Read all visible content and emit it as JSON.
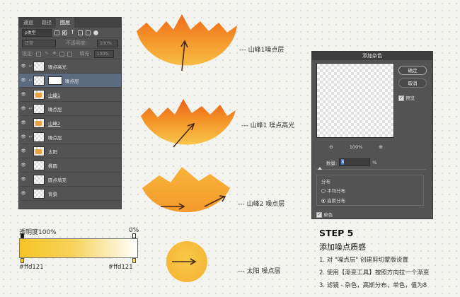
{
  "layers_panel": {
    "tabs": [
      "通道",
      "路径",
      "图层"
    ],
    "filter_label": "ρ类型",
    "blend_mode": "正常",
    "opacity_label": "不透明度:",
    "opacity_value": "100%",
    "lock_label": "锁定:",
    "fill_label": "填充:",
    "fill_value": "100%",
    "layers": [
      {
        "name": "噪点高光",
        "clip": true,
        "selected": false
      },
      {
        "name": "噪点层",
        "clip": true,
        "mask": true,
        "selected": true
      },
      {
        "name": "山峰1",
        "clip": false,
        "selected": false
      },
      {
        "name": "噪点层",
        "clip": true,
        "selected": false
      },
      {
        "name": "山峰2",
        "clip": false,
        "selected": false
      },
      {
        "name": "噪点层",
        "clip": true,
        "selected": false
      },
      {
        "name": "太阳",
        "clip": false,
        "selected": false
      },
      {
        "name": "椭圆",
        "clip": false,
        "selected": false
      },
      {
        "name": "圆点填充",
        "clip": false,
        "selected": false
      },
      {
        "name": "背景",
        "clip": false,
        "selected": false
      }
    ]
  },
  "gradient_editor": {
    "opacity_label": "透明度100%",
    "right_label": "0%",
    "left_color": "#ffd121",
    "right_color": "#ffd121"
  },
  "annotations": {
    "a1": "--- 山峰1噪点层",
    "a2": "--- 山峰1 噪点高光",
    "a3": "--- 山峰2 噪点层",
    "a4": "--- 太阳 噪点层"
  },
  "noise_dialog": {
    "title": "添加杂色",
    "ok_label": "确定",
    "cancel_label": "取消",
    "preview_label": "预览",
    "zoom_value": "100%",
    "amount_label": "数量:",
    "amount_value": "8",
    "amount_unit": "%",
    "distribution_label": "分布",
    "uniform_label": "平均分布",
    "gaussian_label": "高斯分布",
    "mono_label": "单色"
  },
  "step": {
    "title": "STEP 5",
    "subtitle": "添加噪点质感",
    "lines": [
      "1. 对 \"噪点层\" 创建剪切蒙版设置",
      "2. 使用【渐变工具】按照方向拉一个渐变",
      "3. 滤镜 - 杂色，高斯分布，单色，值为8"
    ]
  },
  "colors": {
    "orange_dark": "#f06a1e",
    "orange": "#f59a28",
    "yellow": "#f7c93a"
  }
}
